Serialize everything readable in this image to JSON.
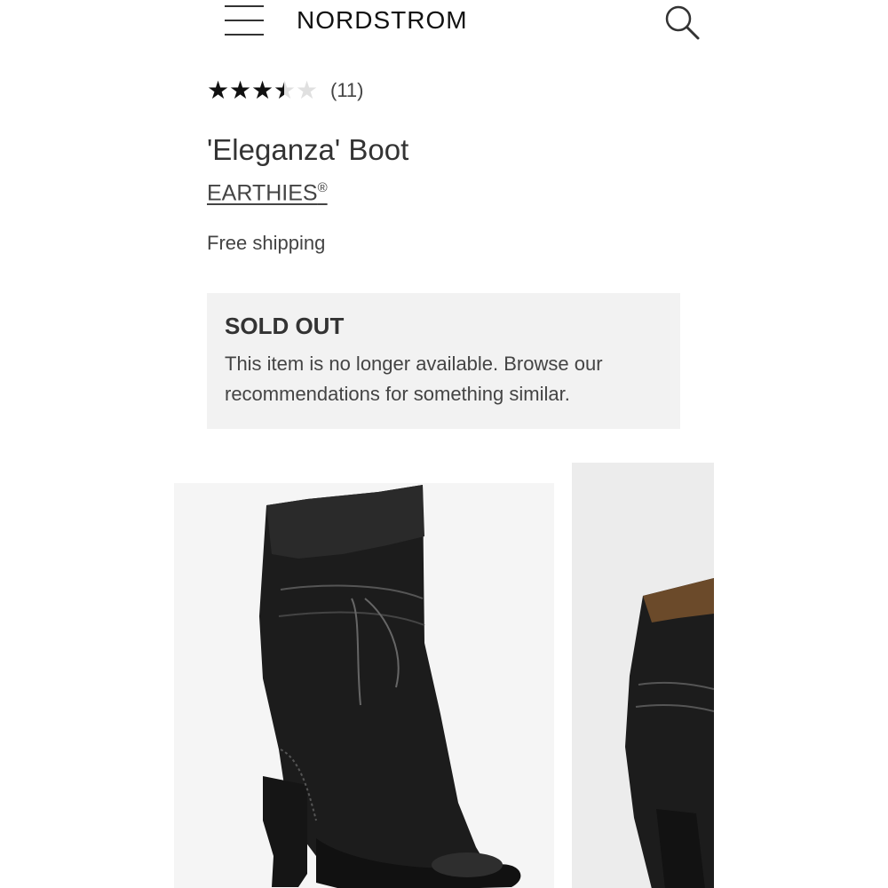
{
  "header": {
    "brand": "NORDSTROM",
    "menu_icon": "hamburger-menu-icon",
    "search_icon": "magnifier-search-icon"
  },
  "product": {
    "rating": 3.5,
    "rating_max": 5,
    "review_count": "(11)",
    "title": "'Eleganza' Boot",
    "brand_name": "EARTHIES",
    "brand_mark": "®",
    "shipping": "Free shipping"
  },
  "availability": {
    "status": "SOLD OUT",
    "message": "This item is no longer available. Browse our recommendations for something similar."
  },
  "colors": {
    "box_background": "#f2f2f2",
    "star_filled": "#111111",
    "star_empty": "#e0e0e0"
  }
}
